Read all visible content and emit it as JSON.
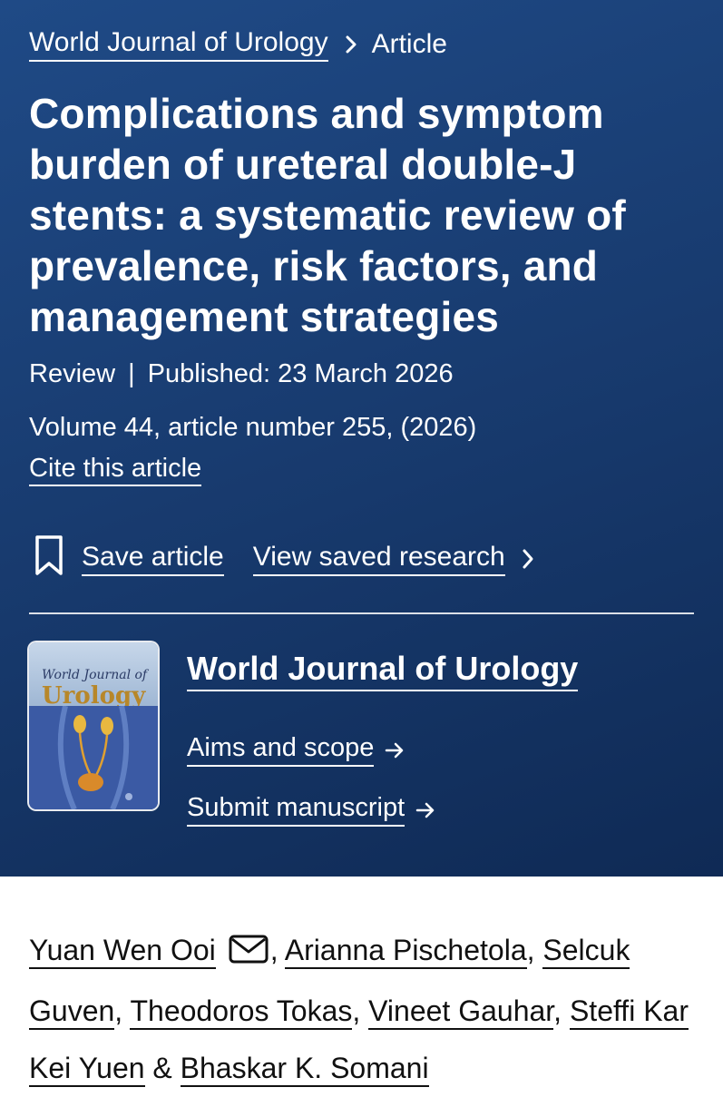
{
  "breadcrumb": {
    "journal": "World Journal of Urology",
    "current": "Article"
  },
  "article": {
    "title": "Complications and symptom burden of ureteral double-J stents: a systematic review of prevalence, risk factors, and management strategies",
    "type": "Review",
    "separator": "|",
    "published": "Published: 23 March 2026",
    "volume": "Volume 44, article number 255, (2026)",
    "cite_label": "Cite this article"
  },
  "actions": {
    "save_label": "Save article",
    "view_saved_label": "View saved research",
    "save_icon": "bookmark-icon",
    "chevron_icon": "chevron-right-icon"
  },
  "journal_box": {
    "name": "World Journal of Urology",
    "cover_line1": "World Journal of",
    "cover_line2": "Urology",
    "aims_label": "Aims and scope",
    "submit_label": "Submit manuscript",
    "arrow_icon": "arrow-right-icon"
  },
  "authors": {
    "list": [
      "Yuan Wen Ooi",
      "Arianna Pischetola",
      "Selcuk Guven",
      "Theodoros Tokas",
      "Vineet Gauhar",
      "Steffi Kar Kei Yuen",
      "Bhaskar K. Somani"
    ],
    "comma": ",",
    "ampersand": "&",
    "corresponding_icon": "mail-icon"
  },
  "colors": {
    "hero_background": "#1a3f76",
    "hero_text": "#ffffff",
    "body_text": "#111111"
  }
}
